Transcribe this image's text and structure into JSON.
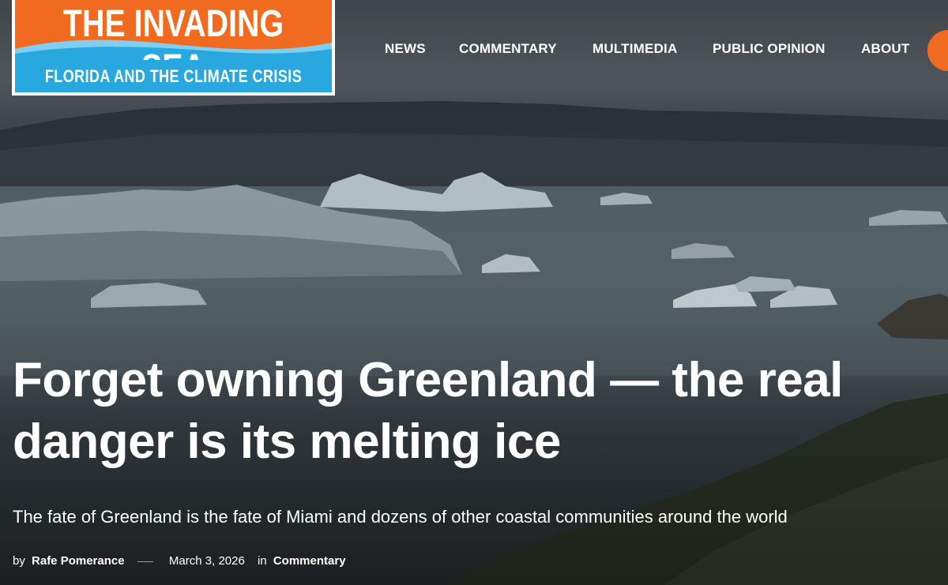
{
  "site": {
    "logo_title": "THE INVADING SEA",
    "logo_subtitle": "FLORIDA AND THE CLIMATE CRISIS",
    "colors": {
      "orange": "#f06b1f",
      "blue": "#29a8e0"
    }
  },
  "nav": {
    "items": [
      {
        "label": "NEWS"
      },
      {
        "label": "COMMENTARY"
      },
      {
        "label": "MULTIMEDIA"
      },
      {
        "label": "PUBLIC OPINION"
      },
      {
        "label": "ABOUT"
      }
    ]
  },
  "article": {
    "headline": "Forget owning Greenland — the real danger is its melting ice",
    "subheadline": "The fate of Greenland is the fate of Miami and dozens of other coastal communities around the world",
    "byline_prefix": "by",
    "author": "Rafe Pomerance",
    "date": "March 3, 2026",
    "category_prefix": "in",
    "category": "Commentary"
  }
}
